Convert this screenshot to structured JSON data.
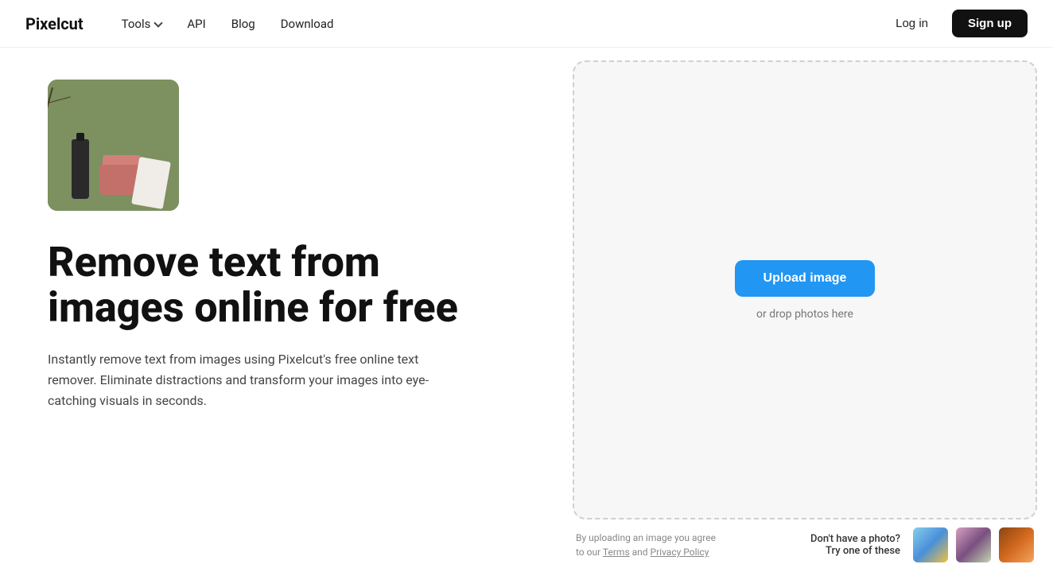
{
  "nav": {
    "logo": "Pixelcut",
    "links": [
      {
        "label": "Tools",
        "hasDropdown": true
      },
      {
        "label": "API",
        "hasDropdown": false
      },
      {
        "label": "Blog",
        "hasDropdown": false
      },
      {
        "label": "Download",
        "hasDropdown": false
      }
    ],
    "login_label": "Log in",
    "signup_label": "Sign up"
  },
  "hero": {
    "title": "Remove text from images online for free",
    "description": "Instantly remove text from images using Pixelcut's free online text remover. Eliminate distractions and transform your images into eye-catching visuals in seconds."
  },
  "upload": {
    "button_label": "Upload image",
    "drop_hint": "or drop photos here",
    "terms_line1": "By uploading an image you agree",
    "terms_line2": "to our Terms and Privacy Policy",
    "sample_label_line1": "Don't have a photo?",
    "sample_label_line2": "Try one of these"
  }
}
